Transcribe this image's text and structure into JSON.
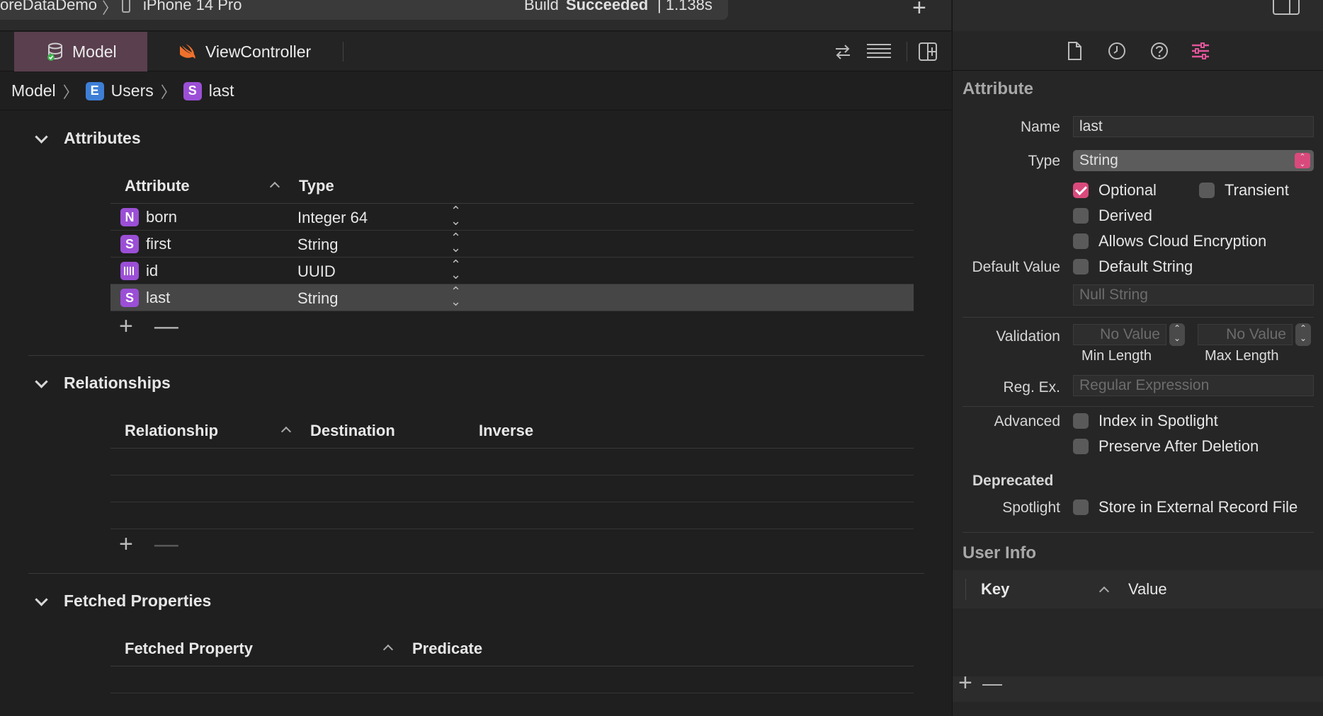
{
  "toolbar": {
    "scheme": "oreDataDemo",
    "device": "iPhone 14 Pro",
    "build_status_prefix": "Build",
    "build_status_bold": "Succeeded",
    "build_time": "| 1.138s"
  },
  "tabs": [
    {
      "label": "Model",
      "icon": "database-icon",
      "active": true
    },
    {
      "label": "ViewController",
      "icon": "swift-icon",
      "active": false
    }
  ],
  "breadcrumb": {
    "root": "Model",
    "entity": {
      "badge": "E",
      "label": "Users"
    },
    "attribute": {
      "badge": "S",
      "label": "last"
    }
  },
  "attributes": {
    "title": "Attributes",
    "col_attribute": "Attribute",
    "col_type": "Type",
    "rows": [
      {
        "badge": "N",
        "name": "born",
        "type": "Integer 64"
      },
      {
        "badge": "S",
        "name": "first",
        "type": "String"
      },
      {
        "badge": "uuid",
        "name": "id",
        "type": "UUID"
      },
      {
        "badge": "S",
        "name": "last",
        "type": "String",
        "selected": true
      }
    ]
  },
  "relationships": {
    "title": "Relationships",
    "col_relationship": "Relationship",
    "col_destination": "Destination",
    "col_inverse": "Inverse"
  },
  "fetched": {
    "title": "Fetched Properties",
    "col_property": "Fetched Property",
    "col_predicate": "Predicate"
  },
  "inspector": {
    "title": "Attribute",
    "name_label": "Name",
    "name_value": "last",
    "type_label": "Type",
    "type_value": "String",
    "optional": "Optional",
    "transient": "Transient",
    "derived": "Derived",
    "cloud_encryption": "Allows Cloud Encryption",
    "default_value_label": "Default Value",
    "default_string": "Default String",
    "null_string_placeholder": "Null String",
    "validation_label": "Validation",
    "min_placeholder": "No Value",
    "max_placeholder": "No Value",
    "min_label": "Min Length",
    "max_label": "Max Length",
    "regex_label": "Reg. Ex.",
    "regex_placeholder": "Regular Expression",
    "advanced_label": "Advanced",
    "index_spotlight": "Index in Spotlight",
    "preserve_after_deletion": "Preserve After Deletion",
    "deprecated_label": "Deprecated",
    "spotlight_label": "Spotlight",
    "store_external": "Store in External Record File",
    "user_info_title": "User Info",
    "col_key": "Key",
    "col_value": "Value"
  },
  "colors": {
    "accent": "#d94a7c",
    "active_tab": "#5a3f4e",
    "badge_purple": "#9b4fd6",
    "badge_blue": "#3e7fd6"
  }
}
